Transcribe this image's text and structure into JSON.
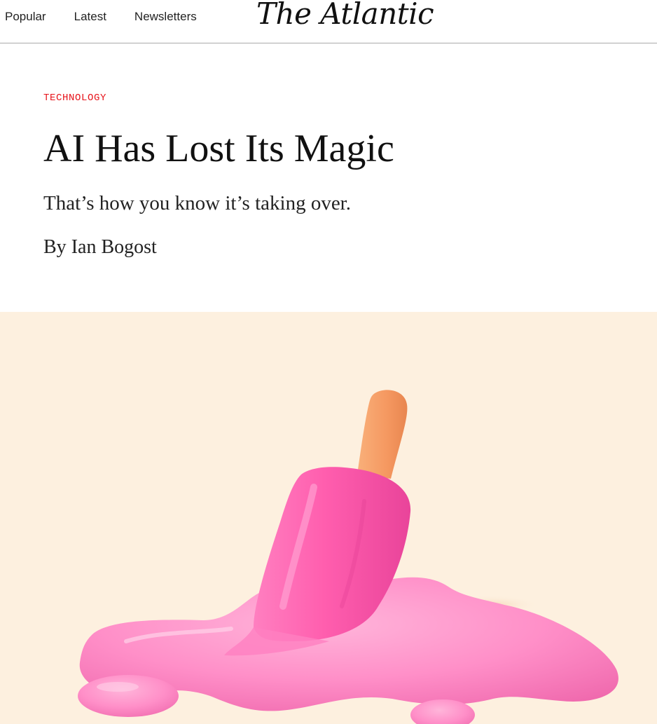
{
  "nav": {
    "items": [
      "Popular",
      "Latest",
      "Newsletters"
    ]
  },
  "brand": {
    "logo_text": "The Atlantic"
  },
  "article": {
    "section": "TECHNOLOGY",
    "title": "AI Has Lost Its Magic",
    "dek": "That’s how you know it’s taking over.",
    "byline_prefix": "By",
    "author": "Ian Bogost"
  },
  "colors": {
    "section_red": "#e7131a",
    "hero_background": "#fdf0df",
    "popsicle_pink": "#ff6fb8",
    "stick_orange": "#f7a56b"
  },
  "hero_image": {
    "icon": "melting-pink-popsicle-illustration"
  }
}
